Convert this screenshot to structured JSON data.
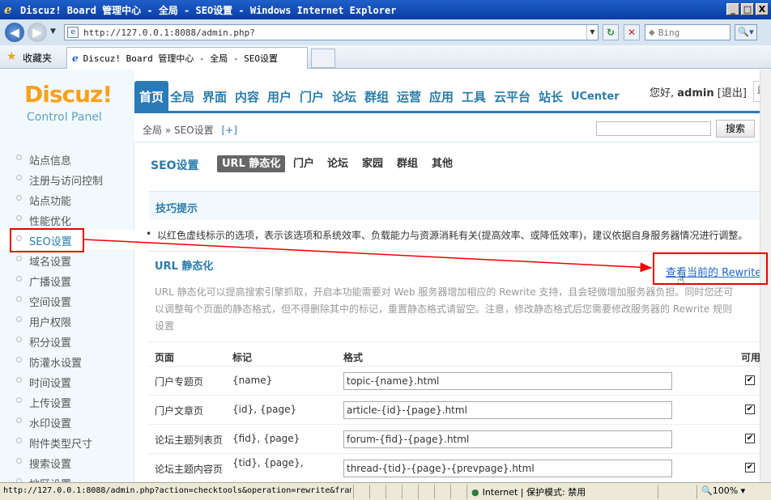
{
  "window": {
    "title": "Discuz! Board 管理中心 - 全局 - SEO设置 - Windows Internet Explorer",
    "min": "_",
    "max": "□",
    "close": "X"
  },
  "browser": {
    "url": "http://127.0.0.1:8088/admin.php?",
    "search_placeholder": "Bing",
    "favorites_label": "收藏夹",
    "tab_title": "Discuz! Board 管理中心 - 全局 - SEO设置"
  },
  "header": {
    "logo_text": "Discuz!",
    "logo_sub": "Control Panel",
    "nav": [
      "首页",
      "全局",
      "界面",
      "内容",
      "用户",
      "门户",
      "论坛",
      "群组",
      "运营",
      "应用",
      "工具",
      "云平台",
      "站长",
      "UCenter"
    ],
    "greeting": "您好,",
    "username": "admin",
    "logout": "[退出]",
    "site_partial": "站"
  },
  "subbar": {
    "breadcrumb": "全局 » SEO设置",
    "add": "[+]",
    "search_button": "搜索"
  },
  "sidebar": {
    "items": [
      "站点信息",
      "注册与访问控制",
      "站点功能",
      "性能优化",
      "SEO设置",
      "域名设置",
      "广播设置",
      "空间设置",
      "用户权限",
      "积分设置",
      "防灌水设置",
      "时间设置",
      "上传设置",
      "水印设置",
      "附件类型尺寸",
      "搜索设置",
      "地区设置"
    ]
  },
  "main": {
    "title": "SEO设置",
    "tabs": [
      "URL 静态化",
      "门户",
      "论坛",
      "家园",
      "群组",
      "其他"
    ],
    "tip_title": "技巧提示",
    "tip_text": "以红色虚线标示的选项，表示该选项和系统效率、负载能力与资源消耗有关(提高效率、或降低效率)，建议依据自身服务器情况进行调整。",
    "section_title": "URL 静态化",
    "rewrite_link": "查看当前的 Rewrite 规",
    "description": "URL 静态化可以提高搜索引擎抓取，开启本功能需要对 Web 服务器增加相应的 Rewrite 支持，且会轻微增加服务器负担。同时您还可以调整每个页面的静态格式，但不得删除其中的标记，重置静态格式请留空。注意，修改静态格式后您需要修改服务器的 Rewrite 规则设置",
    "table": {
      "headers": [
        "页面",
        "标记",
        "格式",
        "可用"
      ],
      "rows": [
        {
          "page": "门户专题页",
          "tags": "{name}",
          "format": "topic-{name}.html",
          "enabled": true
        },
        {
          "page": "门户文章页",
          "tags": "{id}, {page}",
          "format": "article-{id}-{page}.html",
          "enabled": true
        },
        {
          "page": "论坛主题列表页",
          "tags": "{fid}, {page}",
          "format": "forum-{fid}-{page}.html",
          "enabled": true
        },
        {
          "page": "论坛主题内容页",
          "tags": "{tid}, {page},",
          "format": "thread-{tid}-{page}-{prevpage}.html",
          "enabled": true
        }
      ]
    }
  },
  "statusbar": {
    "url": "http://127.0.0.1:8088/admin.php?action=checktools&operation=rewrite&frames=yes",
    "zone": "Internet | 保护模式: 禁用",
    "zoom": "100%"
  },
  "colors": {
    "accent": "#2b7bb9",
    "logo_orange": "#f9a11b",
    "annotation_red": "#e00000"
  }
}
